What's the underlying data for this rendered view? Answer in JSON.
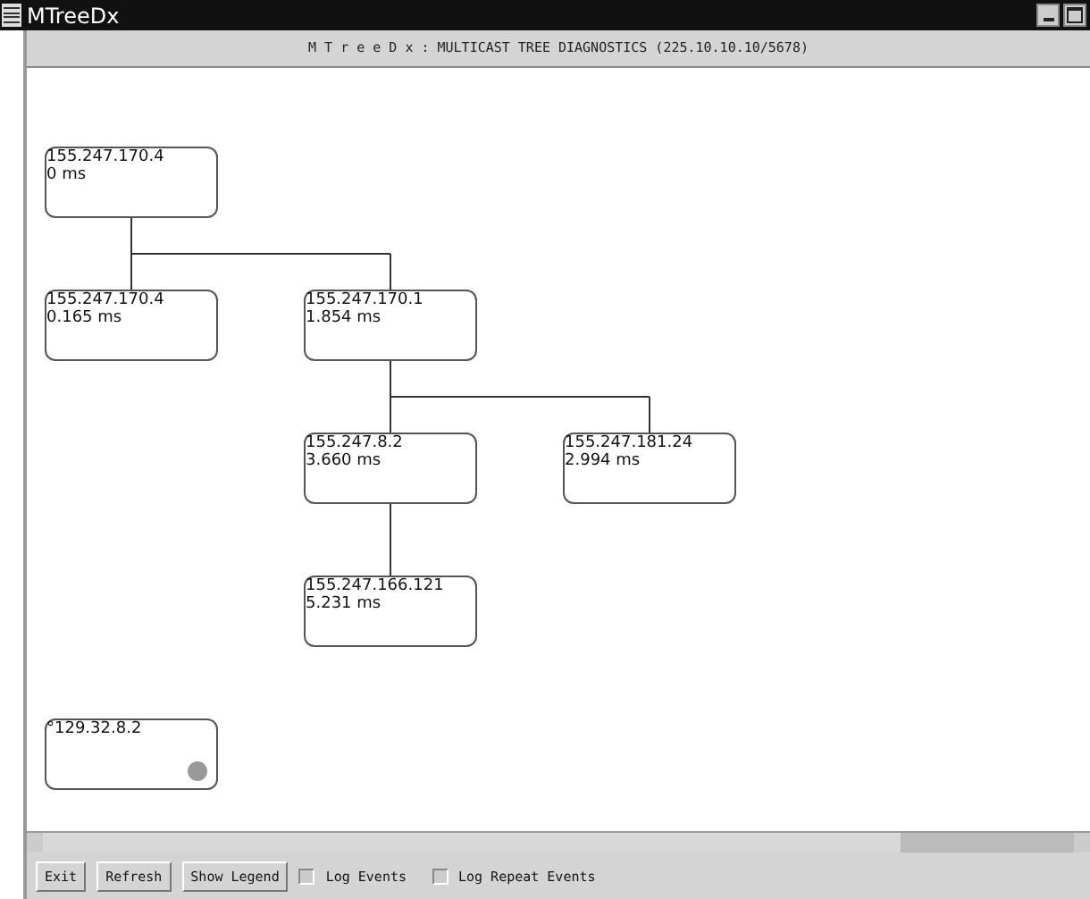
{
  "window": {
    "title": "MTreeDx"
  },
  "header": "M T r e e D x : MULTICAST TREE DIAGNOSTICS (225.10.10.10/5678)",
  "tree": [
    {
      "address": "155.247.170.4",
      "latency": "0 ms",
      "dot": false,
      "children": [
        {
          "address": "155.247.170.4",
          "latency": "0.165 ms",
          "dot": false
        },
        {
          "address": "155.247.170.1",
          "latency": "1.854 ms",
          "dot": false,
          "children": [
            {
              "address": "155.247.8.2",
              "latency": "3.660 ms",
              "dot": false,
              "children": [
                {
                  "address": "155.247.166.121",
                  "latency": "5.231 ms",
                  "dot": false
                }
              ]
            },
            {
              "address": "155.247.181.24",
              "latency": "2.994 ms",
              "dot": false
            }
          ]
        }
      ]
    },
    {
      "address": "°129.32.8.2",
      "dot": true
    }
  ],
  "buttons": [
    "Exit",
    "Refresh",
    "Show Legend"
  ],
  "checkboxes": [
    {
      "label": "Log Events",
      "checked": false
    },
    {
      "label": "Log Repeat Events",
      "checked": false
    }
  ]
}
